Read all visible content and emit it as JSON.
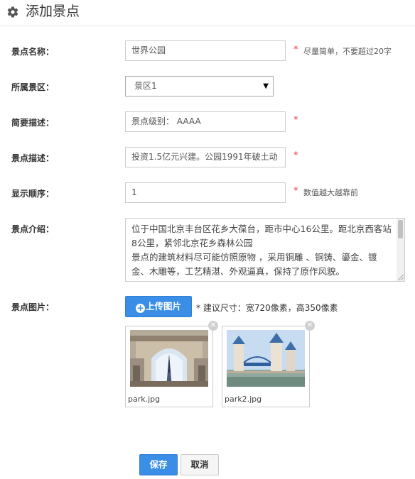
{
  "header": {
    "title": "添加景点",
    "icon": "gear-icon"
  },
  "form": {
    "name": {
      "label": "景点名称：",
      "value": "世界公园",
      "required": "*",
      "hint": "尽量简单，不要超过20字"
    },
    "area": {
      "label": "所属景区：",
      "value": "景区1"
    },
    "brief": {
      "label": "简要描述：",
      "value": "景点级别： AAAA",
      "required": "*"
    },
    "desc": {
      "label": "景点描述：",
      "value": "投资1.5亿元兴建。公园1991年破土动",
      "required": "*"
    },
    "order": {
      "label": "显示顺序：",
      "value": "1",
      "required": "*",
      "hint": "数值越大越靠前"
    },
    "intro": {
      "label": "景点介绍：",
      "value": "位于中国北京丰台区花乡大葆台，距市中心16公里。距北京西客站8公里，紧邻北京花乡森林公园\n景点的建筑材料尽可能仿照原物 ，采用铜雕 、铜铸、鎏金、镀金、木雕等，工艺精湛、外观逼真，保持了原作风貌。"
    },
    "images": {
      "label": "景点图片：",
      "upload_label": "上传图片",
      "hint_star": "*",
      "hint": "建议尺寸：宽720像素，高350像素",
      "files": [
        {
          "name": "park.jpg"
        },
        {
          "name": "park2.jpg"
        }
      ]
    }
  },
  "actions": {
    "save": "保存",
    "cancel": "取消"
  },
  "colors": {
    "primary": "#3a8ee6",
    "required": "#e4393c"
  }
}
